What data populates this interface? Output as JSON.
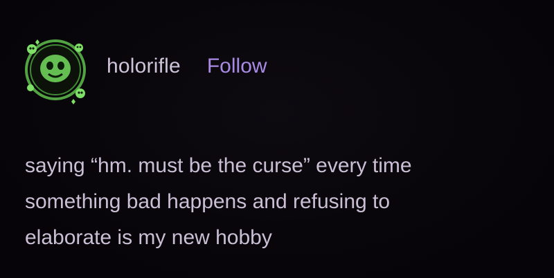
{
  "post": {
    "username": "holorifle",
    "follow_label": "Follow",
    "text_lines": [
      "saying “hm. must be the curse” every time",
      "something bad happens and refusing to",
      "elaborate is my new hobby"
    ]
  },
  "colors": {
    "background": "#08050a",
    "text": "#cbbfd6",
    "accent": "#a98be6",
    "avatar_green": "#6fd15a"
  },
  "icons": {
    "avatar": "skull-ring-avatar-icon"
  }
}
